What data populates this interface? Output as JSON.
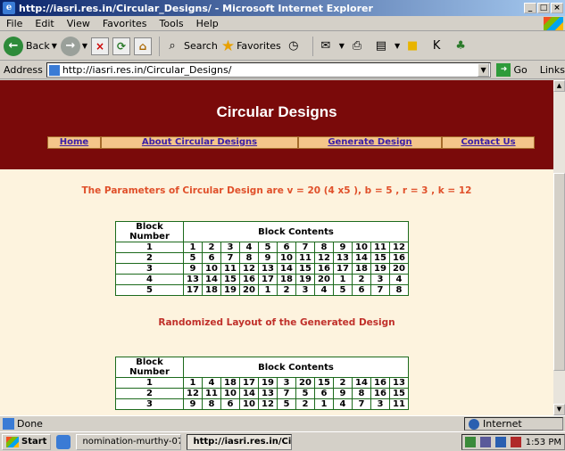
{
  "window": {
    "title": "http://iasri.res.in/Circular_Designs/ - Microsoft Internet Explorer"
  },
  "menu": [
    "File",
    "Edit",
    "View",
    "Favorites",
    "Tools",
    "Help"
  ],
  "toolbar": {
    "back_label": "Back",
    "search_label": "Search",
    "favorites_label": "Favorites"
  },
  "address": {
    "label": "Address",
    "url": "http://iasri.res.in/Circular_Designs/",
    "go_label": "Go",
    "links_label": "Links"
  },
  "page": {
    "heading": "Circular Designs",
    "nav": [
      "Home",
      "About Circular Designs",
      "Generate Design",
      "Contact Us"
    ],
    "params_text": "The Parameters of Circular Design are v = 20 (4 x5 ), b = 5 , r = 3 , k = 12",
    "table1": {
      "header_block": "Block Number",
      "header_contents": "Block Contents",
      "rows": [
        {
          "block": "1",
          "cells": [
            "1",
            "2",
            "3",
            "4",
            "5",
            "6",
            "7",
            "8",
            "9",
            "10",
            "11",
            "12"
          ]
        },
        {
          "block": "2",
          "cells": [
            "5",
            "6",
            "7",
            "8",
            "9",
            "10",
            "11",
            "12",
            "13",
            "14",
            "15",
            "16"
          ]
        },
        {
          "block": "3",
          "cells": [
            "9",
            "10",
            "11",
            "12",
            "13",
            "14",
            "15",
            "16",
            "17",
            "18",
            "19",
            "20"
          ]
        },
        {
          "block": "4",
          "cells": [
            "13",
            "14",
            "15",
            "16",
            "17",
            "18",
            "19",
            "20",
            "1",
            "2",
            "3",
            "4"
          ]
        },
        {
          "block": "5",
          "cells": [
            "17",
            "18",
            "19",
            "20",
            "1",
            "2",
            "3",
            "4",
            "5",
            "6",
            "7",
            "8"
          ]
        }
      ]
    },
    "layout_title": "Randomized Layout of the Generated Design",
    "table2": {
      "header_block": "Block Number",
      "header_contents": "Block Contents",
      "rows": [
        {
          "block": "1",
          "cells": [
            "1",
            "4",
            "18",
            "17",
            "19",
            "3",
            "20",
            "15",
            "2",
            "14",
            "16",
            "13"
          ]
        },
        {
          "block": "2",
          "cells": [
            "12",
            "11",
            "10",
            "14",
            "13",
            "7",
            "5",
            "6",
            "9",
            "8",
            "16",
            "15"
          ]
        },
        {
          "block": "3",
          "cells": [
            "9",
            "8",
            "6",
            "10",
            "12",
            "5",
            "2",
            "1",
            "4",
            "7",
            "3",
            "11"
          ]
        }
      ]
    }
  },
  "status": {
    "text": "Done",
    "zone": "Internet"
  },
  "taskbar": {
    "start": "Start",
    "tasks": [
      "nomination-murthy-07 - ...",
      "http://iasri.res.in/Cir..."
    ],
    "clock": "1:53 PM"
  }
}
